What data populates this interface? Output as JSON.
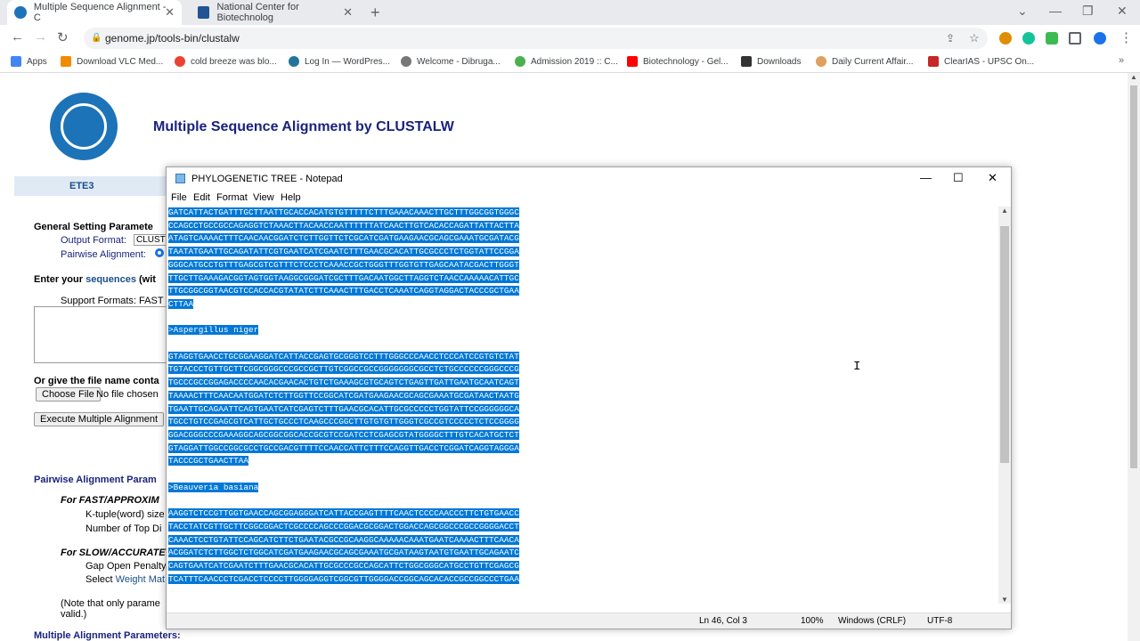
{
  "browser": {
    "tabs": [
      {
        "title": "Multiple Sequence Alignment - C",
        "active": true
      },
      {
        "title": "National Center for Biotechnolog",
        "active": false
      }
    ],
    "url": "genome.jp/tools-bin/clustalw",
    "bookmarks": [
      "Apps",
      "Download VLC Med...",
      "cold breeze was blo...",
      "Log In — WordPres...",
      "Welcome - Dibruga...",
      "Admission 2019 :: C...",
      "Biotechnology - Gel...",
      "Downloads",
      "Daily Current Affair...",
      "ClearIAS - UPSC On..."
    ],
    "colors": {
      "accent": "#1a73e8",
      "tab_bar": "#e8eaed"
    }
  },
  "page": {
    "title": "Multiple Sequence Alignment by CLUSTALW",
    "ete_label": "ETE3",
    "general_settings": "General Setting Paramete",
    "output_format_label": "Output Format:",
    "output_format_value": "CLUST",
    "pairwise_alignment_label": "Pairwise Alignment:",
    "enter_sequences_prefix": "Enter your",
    "enter_sequences_link": "sequences",
    "enter_sequences_suffix": "(wit",
    "support_formats": "Support Formats: FAST",
    "file_name_label": "Or give the file name conta",
    "choose_file_button": "Choose File",
    "no_file_chosen": "No file chosen",
    "execute_button": "Execute Multiple Alignment",
    "pairwise_params": "Pairwise Alignment Param",
    "fast_label": "For FAST/APPROXIM",
    "ktuple_label": "K-tuple(word) size",
    "top_diag_label": "Number of Top Di",
    "slow_label": "For SLOW/ACCURATE",
    "gap_open_label": "Gap Open Penalty",
    "select_label": "Select",
    "weight_matrix_link": "Weight Mat",
    "note_text": "(Note that only parame",
    "note_text2": "valid.)",
    "multiple_params": "Multiple Alignment Parameters:"
  },
  "notepad": {
    "title": "PHYLOGENETIC TREE - Notepad",
    "menu": [
      "File",
      "Edit",
      "Format",
      "View",
      "Help"
    ],
    "content": "GATCATTACTGATTTGCTTAATTGCACCACATGTGTTTTTCTTTGAAACAAACTTGCTTTGGCGGTGGGC\nCCAGCCTGCCGCCAGAGGTCTAAACTTACAACCAATTTTTTATCAACTTGTCACACCAGATTATTACTTA\nATAGTCAAAACTTTCAACAACGGATCTCTTGGTTCTCGCATCGATGAAGAACGCAGCGAAATGCGATACG\nTAATATGAATTGCAGATATTCGTGAATCATCGAATCTTTGAACGCACATTGCGCCCTCTGGTATTCCGGA\nGGGCATGCCTGTTTGAGCGTCGTTTCTCCCTCAAACCGCTGGGTTTGGTGTTGAGCAATACGACTTGGGT\nTTGCTTGAAAGACGGTAGTGGTAAGGCGGGATCGCTTTGACAATGGCTTAGGTCTAACCAAAAACATTGC\nTTGCGGCGGTAACGTCCACCACGTATATCTTCAAACTTTGACCTCAAATCAGGTAGGACTACCCGCTGAA\nCTTAA\n\n>Aspergillus niger\n\nGTAGGTGAACCTGCGGAAGGATCATTACCGAGTGCGGGTCCTTTGGGCCCAACCTCCCATCCGTGTCTAT\nTGTACCCTGTTGCTTCGGCGGGCCCGCCGCTTGTCGGCCGCCGGGGGGGCGCCTCTGCCCCCCGGGCCCG\nTGCCCGCCGGAGACCCCAACACGAACACTGTCTGAAAGCGTGCAGTCTGAGTTGATTGAATGCAATCAGT\nTAAAACTTTCAACAATGGATCTCTTGGTTCCGGCATCGATGAAGAACGCAGCGAAATGCGATAACTAATG\nTGAATTGCAGAATTCAGTGAATCATCGAGTCTTTGAACGCACATTGCGCCCCCTGGTATTCCGGGGGGCA\nTGCCTGTCCGAGCGTCATTGCTGCCCTCAAGCCCGGCTTGTGTGTTGGGTCGCCGTCCCCCTCTCCGGGG\nGGACGGGCCCGAAAGGCAGCGGCGGCACCGCGTCCGATCCTCGAGCGTATGGGGCTTTGTCACATGCTCT\nGTAGGATTGGCCGGCGCCTGCCGACGTTTTCCAACCATTCTTTCCAGGTTGACCTCGGATCAGGTAGGGA\nTACCCGCTGAACTTAA\n\n>Beauveria basiana\n\nAAGGTCTCCGTTGGTGAACCAGCGGAGGGATCATTACCGAGTTTTCAACTCCCCAACCCTTCTGTGAACC\nTACCTATCGTTGCTTCGGCGGACTCGCCCCAGCCCGGACGCGGACTGGACCAGCGGCCCGCCGGGGACCT\nCAAACTCCTGTATTCCAGCATCTTCTGAATACGCCGCAAGGCAAAAACAAATGAATCAAAACTTTCAACA\nACGGATCTCTTGGCTCTGGCATCGATGAAGAACGCAGCGAAATGCGATAAGTAATGTGAATTGCAGAATC\nCAGTGAATCATCGAATCTTTGAACGCACATTGCGCCCGCCAGCATTCTGGCGGGCATGCCTGTTCGAGCG\nTCATTTCAACCCTCGACCTCCCCTTGGGGAGGTCGGCGTTGGGGACCGGCAGCACACCGCCGGCCCTGAA",
    "status": {
      "position": "Ln 46, Col 3",
      "zoom": "100%",
      "line_ending": "Windows (CRLF)",
      "encoding": "UTF-8"
    }
  }
}
